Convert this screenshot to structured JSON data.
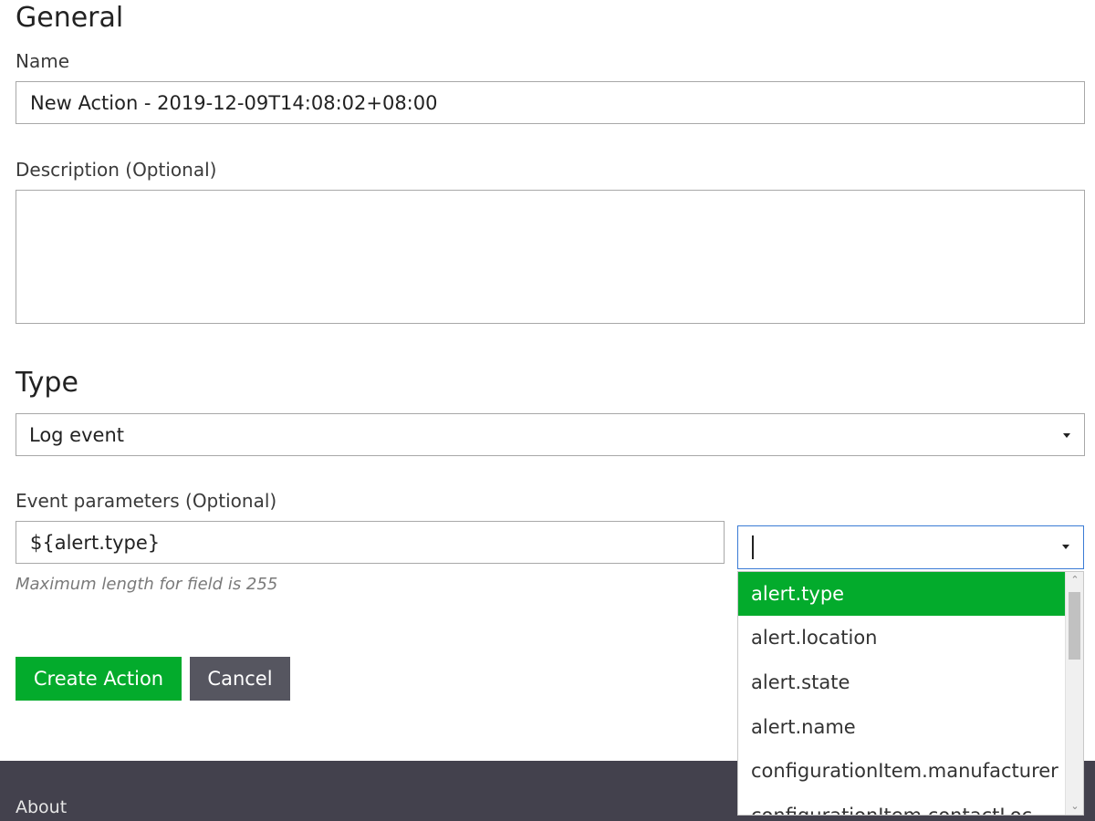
{
  "general": {
    "heading": "General",
    "name_label": "Name",
    "name_value": "New Action - 2019-12-09T14:08:02+08:00",
    "description_label": "Description (Optional)",
    "description_value": ""
  },
  "type": {
    "heading": "Type",
    "selected": "Log event"
  },
  "event_parameters": {
    "label": "Event parameters (Optional)",
    "value": "${alert.type}",
    "hint": "Maximum length for field is 255",
    "combo_value": "",
    "options": [
      {
        "label": "alert.type",
        "selected": true
      },
      {
        "label": "alert.location",
        "selected": false
      },
      {
        "label": "alert.state",
        "selected": false
      },
      {
        "label": "alert.name",
        "selected": false
      },
      {
        "label": "configurationItem.manufacturer",
        "selected": false
      },
      {
        "label": "configurationItem.contactLoc",
        "selected": false
      }
    ]
  },
  "buttons": {
    "create": "Create Action",
    "cancel": "Cancel"
  },
  "footer": {
    "about": "About"
  },
  "icons": {
    "type_caret": "chevron-down-icon",
    "combo_caret": "chevron-down-icon",
    "scroll_up": "scroll-up-icon",
    "scroll_down": "scroll-down-icon"
  },
  "colors": {
    "primary": "#03ab2c",
    "secondary": "#565660",
    "footer": "#43414d",
    "focus": "#3a7bd5"
  }
}
